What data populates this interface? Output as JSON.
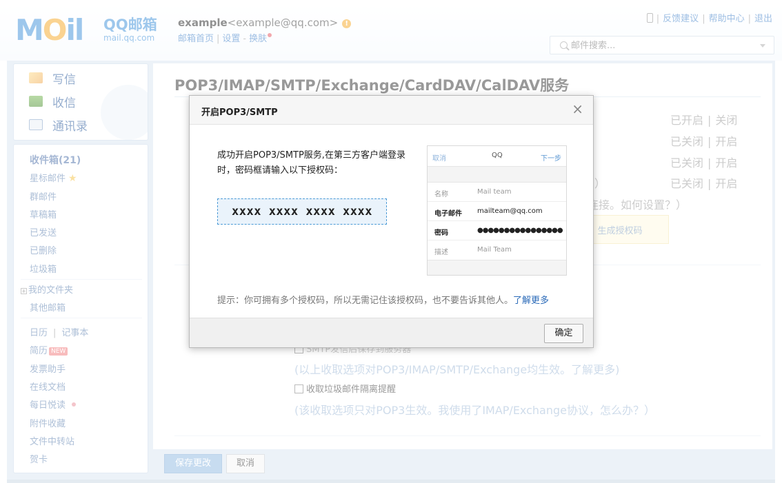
{
  "header": {
    "logo_text": "MOil",
    "logo_cn": "QQ邮箱",
    "logo_domain": "mail.qq.com",
    "user_name": "example",
    "user_email": "<example@qq.com>",
    "links": [
      "邮箱首页",
      "设置",
      "换肤"
    ],
    "top_links": [
      "反馈建议",
      "帮助中心",
      "退出"
    ],
    "search_placeholder": "邮件搜索..."
  },
  "sidebar": {
    "top": [
      {
        "label": "写信",
        "icon": "write-icon"
      },
      {
        "label": "收信",
        "icon": "inbox-icon"
      },
      {
        "label": "通讯录",
        "icon": "contacts-icon"
      }
    ],
    "inbox": "收件箱(21)",
    "folders": [
      "星标邮件",
      "群邮件",
      "草稿箱",
      "已发送",
      "已删除",
      "垃圾箱"
    ],
    "my_folders": "我的文件夹",
    "other_mailbox": "其他邮箱",
    "calendar": "日历",
    "notes": "记事本",
    "resume": "简历",
    "new_tag": "NEW",
    "apps": [
      "发票助手",
      "在线文档",
      "每日悦读",
      "附件收藏",
      "文件中转站",
      "贺卡"
    ]
  },
  "main": {
    "title": "POP3/IMAP/SMTP/Exchange/CardDAV/CalDAV服务",
    "status_rows": [
      {
        "state": "已开启",
        "action": "关闭"
      },
      {
        "state": "已关闭",
        "action": "开启"
      },
      {
        "state": "已关闭",
        "action": "开启"
      },
      {
        "state": "已关闭",
        "action": "开启"
      }
    ],
    "paren_close": "）",
    "bg_link_tail": "连接。如何设置？）",
    "tip_box": "）。生成授权码",
    "smtp_partial": "SMTP发信后保存到服务器",
    "note1": "(以上收取选项对POP3/IMAP/SMTP/Exchange均生效。了解更多)",
    "checkbox_junk": "收取垃圾邮件隔离提醒",
    "note2": "(该收取选项只对POP3生效。我使用了IMAP/Exchange协议，怎么办？）",
    "save_button": "保存更改",
    "cancel_button": "取消"
  },
  "dialog": {
    "title": "开启POP3/SMTP",
    "message": "成功开启POP3/SMTP服务,在第三方客户端登录时，密码框请输入以下授权码：",
    "auth_code": "xxxx xxxx xxxx xxxx",
    "phone": {
      "cancel": "取消",
      "title": "QQ",
      "next": "下一步",
      "rows": [
        {
          "key": "名称",
          "value": "Mail team"
        },
        {
          "key": "电子邮件",
          "value": "mailteam@qq.com"
        },
        {
          "key": "密码",
          "value": "●●●●●●●●●●●●●●●●"
        },
        {
          "key": "描述",
          "value": "Mail Team"
        }
      ]
    },
    "hint": "提示：你可拥有多个授权码，所以无需记住该授权码，也不要告诉其他人。",
    "hint_link": "了解更多",
    "ok_button": "确定"
  }
}
